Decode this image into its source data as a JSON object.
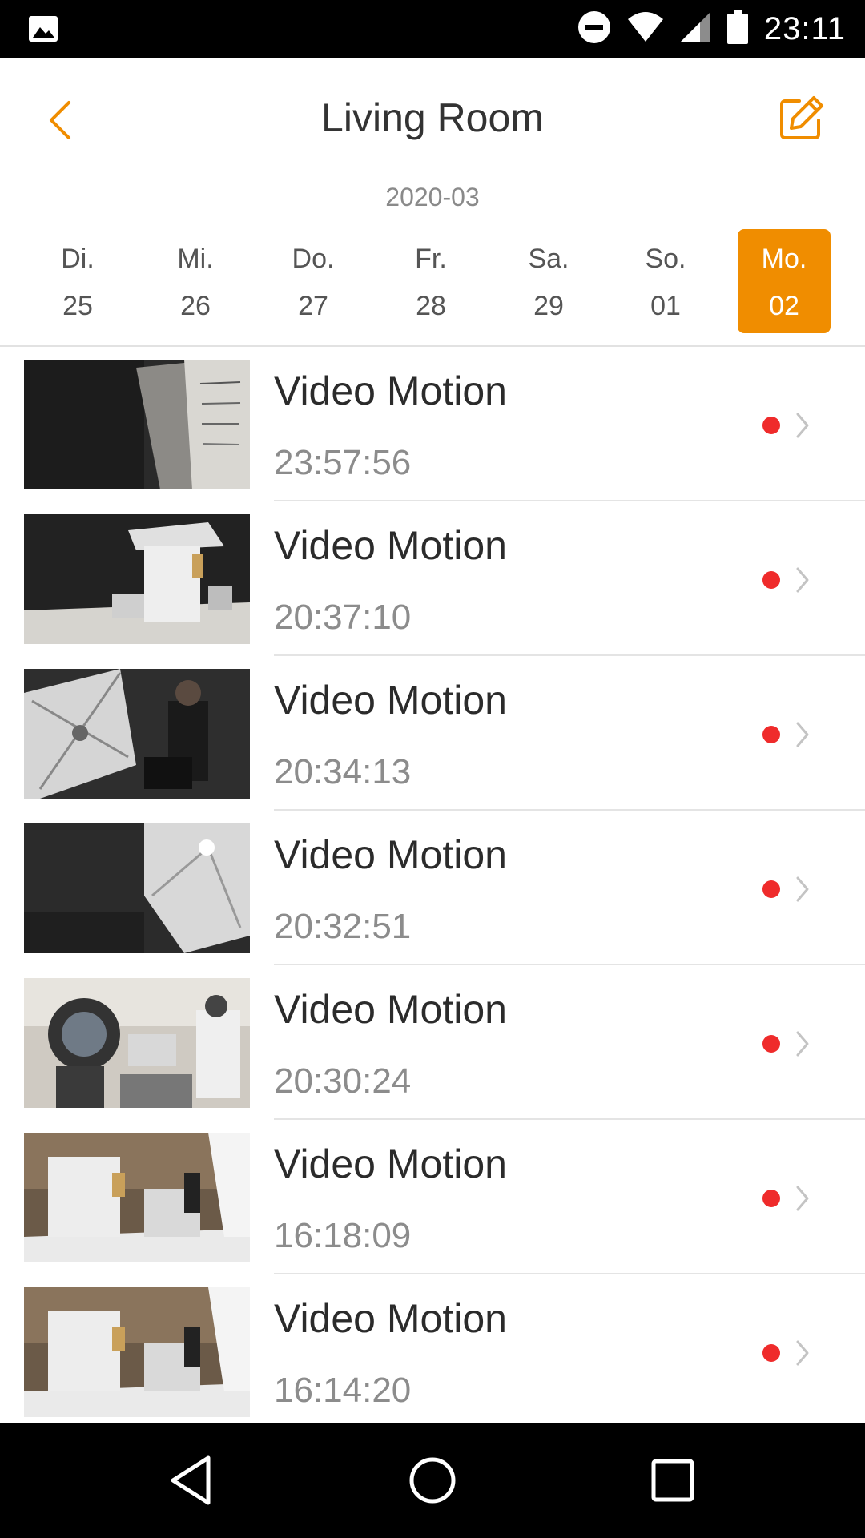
{
  "status_bar": {
    "time": "23:11",
    "icons": [
      "gallery-icon",
      "do-not-disturb-icon",
      "wifi-icon",
      "signal-icon",
      "battery-icon"
    ]
  },
  "header": {
    "title": "Living Room",
    "back_icon": "chevron-left-icon",
    "edit_icon": "edit-icon"
  },
  "calendar": {
    "month": "2020-03",
    "days": [
      {
        "name": "Di.",
        "num": "25"
      },
      {
        "name": "Mi.",
        "num": "26"
      },
      {
        "name": "Do.",
        "num": "27"
      },
      {
        "name": "Fr.",
        "num": "28"
      },
      {
        "name": "Sa.",
        "num": "29"
      },
      {
        "name": "So.",
        "num": "01"
      },
      {
        "name": "Mo.",
        "num": "02"
      }
    ],
    "selected_index": 6
  },
  "events": [
    {
      "title": "Video Motion",
      "time": "23:57:56"
    },
    {
      "title": "Video Motion",
      "time": "20:37:10"
    },
    {
      "title": "Video Motion",
      "time": "20:34:13"
    },
    {
      "title": "Video Motion",
      "time": "20:32:51"
    },
    {
      "title": "Video Motion",
      "time": "20:30:24"
    },
    {
      "title": "Video Motion",
      "time": "16:18:09"
    },
    {
      "title": "Video Motion",
      "time": "16:14:20"
    }
  ],
  "colors": {
    "accent": "#f08d00",
    "recording_dot": "#ef2b2b"
  },
  "nav_bar": {
    "icons": [
      "back-triangle-icon",
      "home-circle-icon",
      "recents-square-icon"
    ]
  }
}
